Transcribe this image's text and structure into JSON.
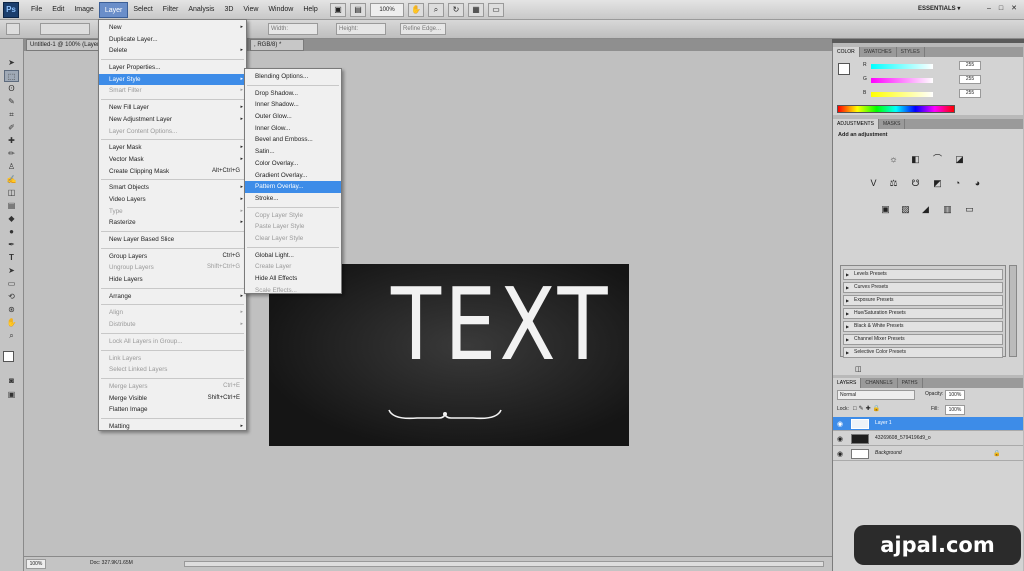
{
  "app": {
    "logo": "Ps",
    "essentials": "ESSENTIALS ▾",
    "zoom_level": "100%"
  },
  "menubar": {
    "items": [
      "File",
      "Edit",
      "Image",
      "Layer",
      "Select",
      "Filter",
      "Analysis",
      "3D",
      "View",
      "Window",
      "Help"
    ],
    "active": "Layer"
  },
  "options": {
    "width_label": "Width:",
    "height_label": "Height:",
    "refine_label": "Refine Edge..."
  },
  "doc_tabs": {
    "tab1": "Untitled-1 @ 100% (Layer",
    "tab2": ", RGB/8) *"
  },
  "canvas": {
    "headline": "TEXT",
    "ornament_color": "#f2f2f2"
  },
  "status": {
    "zoom": "100%",
    "doc": "Doc: 327.9K/1.65M"
  },
  "layer_menu": {
    "items": [
      {
        "label": "New",
        "arrow": "▸"
      },
      {
        "label": "Duplicate Layer..."
      },
      {
        "label": "Delete",
        "arrow": "▸"
      },
      {
        "sep": true
      },
      {
        "label": "Layer Properties..."
      },
      {
        "label": "Layer Style",
        "arrow": "▸",
        "highlight": true
      },
      {
        "label": "Smart Filter",
        "arrow": "▸",
        "disabled": true
      },
      {
        "sep": true
      },
      {
        "label": "New Fill Layer",
        "arrow": "▸"
      },
      {
        "label": "New Adjustment Layer",
        "arrow": "▸"
      },
      {
        "label": "Layer Content Options...",
        "disabled": true
      },
      {
        "sep": true
      },
      {
        "label": "Layer Mask",
        "arrow": "▸"
      },
      {
        "label": "Vector Mask",
        "arrow": "▸"
      },
      {
        "label": "Create Clipping Mask",
        "shortcut": "Alt+Ctrl+G"
      },
      {
        "sep": true
      },
      {
        "label": "Smart Objects",
        "arrow": "▸"
      },
      {
        "label": "Video Layers",
        "arrow": "▸"
      },
      {
        "label": "Type",
        "arrow": "▸",
        "disabled": true
      },
      {
        "label": "Rasterize",
        "arrow": "▸"
      },
      {
        "sep": true
      },
      {
        "label": "New Layer Based Slice"
      },
      {
        "sep": true
      },
      {
        "label": "Group Layers",
        "shortcut": "Ctrl+G"
      },
      {
        "label": "Ungroup Layers",
        "shortcut": "Shift+Ctrl+G",
        "disabled": true
      },
      {
        "label": "Hide Layers"
      },
      {
        "sep": true
      },
      {
        "label": "Arrange",
        "arrow": "▸"
      },
      {
        "sep": true
      },
      {
        "label": "Align",
        "arrow": "▸",
        "disabled": true
      },
      {
        "label": "Distribute",
        "arrow": "▸",
        "disabled": true
      },
      {
        "sep": true
      },
      {
        "label": "Lock All Layers in Group...",
        "disabled": true
      },
      {
        "sep": true
      },
      {
        "label": "Link Layers",
        "disabled": true
      },
      {
        "label": "Select Linked Layers",
        "disabled": true
      },
      {
        "sep": true
      },
      {
        "label": "Merge Layers",
        "shortcut": "Ctrl+E",
        "disabled": true
      },
      {
        "label": "Merge Visible",
        "shortcut": "Shift+Ctrl+E"
      },
      {
        "label": "Flatten Image"
      },
      {
        "sep": true
      },
      {
        "label": "Matting",
        "arrow": "▸"
      }
    ]
  },
  "style_menu": {
    "items": [
      {
        "label": "Blending Options..."
      },
      {
        "sep": true
      },
      {
        "label": "Drop Shadow..."
      },
      {
        "label": "Inner Shadow..."
      },
      {
        "label": "Outer Glow..."
      },
      {
        "label": "Inner Glow..."
      },
      {
        "label": "Bevel and Emboss..."
      },
      {
        "label": "Satin..."
      },
      {
        "label": "Color Overlay..."
      },
      {
        "label": "Gradient Overlay..."
      },
      {
        "label": "Pattern Overlay...",
        "highlight": true
      },
      {
        "label": "Stroke..."
      },
      {
        "sep": true
      },
      {
        "label": "Copy Layer Style",
        "disabled": true
      },
      {
        "label": "Paste Layer Style",
        "disabled": true
      },
      {
        "label": "Clear Layer Style",
        "disabled": true
      },
      {
        "sep": true
      },
      {
        "label": "Global Light..."
      },
      {
        "label": "Create Layer",
        "disabled": true
      },
      {
        "label": "Hide All Effects"
      },
      {
        "label": "Scale Effects...",
        "disabled": true
      }
    ]
  },
  "color_panel": {
    "tabs": [
      "COLOR",
      "SWATCHES",
      "STYLES"
    ],
    "channels": [
      {
        "label": "R",
        "value": "255",
        "gradient": "#ff0000"
      },
      {
        "label": "G",
        "value": "255",
        "gradient": "#00ff00"
      },
      {
        "label": "B",
        "value": "255",
        "gradient": "#0000ff"
      }
    ]
  },
  "adjustments_panel": {
    "tabs": [
      "ADJUSTMENTS",
      "MASKS"
    ],
    "heading": "Add an adjustment",
    "row1": [
      "☼",
      "◧",
      "⌒",
      "◪"
    ],
    "row2": [
      "V",
      "⚖",
      "☋",
      "◩",
      "◔",
      "◕"
    ],
    "row3": [
      "▣",
      "▨",
      "◢",
      "▥",
      "▭"
    ],
    "presets": [
      "Levels Presets",
      "Curves Presets",
      "Exposure Presets",
      "Hue/Saturation Presets",
      "Black & White Presets",
      "Channel Mixer Presets",
      "Selective Color Presets"
    ]
  },
  "layers_panel": {
    "tabs": [
      "LAYERS",
      "CHANNELS",
      "PATHS"
    ],
    "blend_mode": "Normal",
    "opacity_label": "Opacity:",
    "opacity": "100%",
    "lock_label": "Lock:",
    "fill_label": "Fill:",
    "fill": "100%",
    "layers": [
      {
        "name": "Layer 1",
        "selected": true
      },
      {
        "name": "43269608_5794196d9_o"
      },
      {
        "name": "Background",
        "italic": true
      }
    ]
  },
  "watermark": "ajpal.com"
}
